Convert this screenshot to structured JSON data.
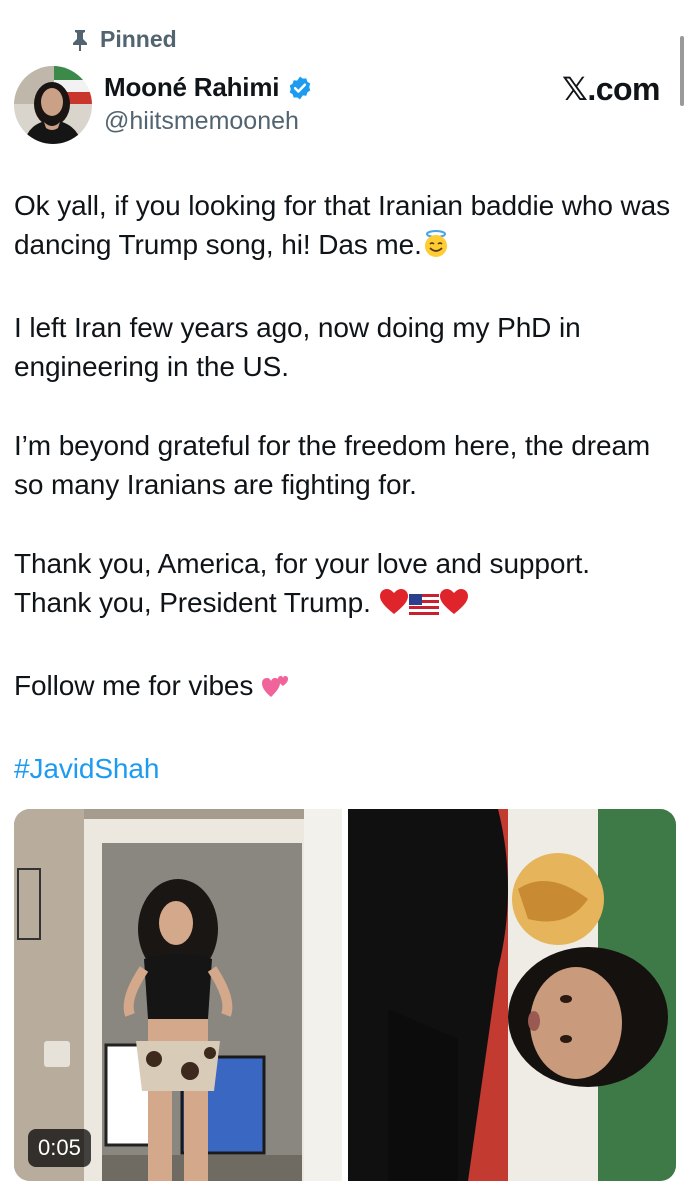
{
  "pinned_label": "Pinned",
  "author": {
    "display_name": "Mooné Rahimi",
    "handle": "@hiitsmemooneh",
    "verified": true
  },
  "brand": "𝕏.com",
  "tweet": {
    "paragraphs": [
      "Ok yall, if you looking for that Iranian baddie who was dancing Trump song, hi! Das me.",
      "I left Iran few years ago, now doing my PhD in engineering in the US.",
      "I’m beyond grateful for the freedom here, the dream so many Iranians are fighting for.",
      "Thank you, America, for your love and support.",
      "Thank you, President Trump.",
      "Follow me for vibes"
    ],
    "hashtag": "#JavidShah"
  },
  "media": {
    "video_duration": "0:05"
  },
  "colors": {
    "text": "#0f1419",
    "secondary": "#536471",
    "link": "#1d9bf0",
    "verified": "#1d9bf0"
  }
}
